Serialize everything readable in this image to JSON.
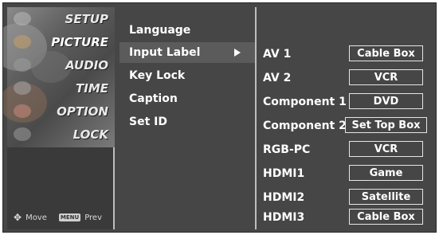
{
  "categories": [
    {
      "label": "SETUP",
      "active": false,
      "deco_color": "#b9b9b9"
    },
    {
      "label": "PICTURE",
      "active": true,
      "deco_color": "#c7a06a"
    },
    {
      "label": "AUDIO",
      "active": false,
      "deco_color": "#9a9a9a"
    },
    {
      "label": "TIME",
      "active": false,
      "deco_color": "#a8a8a8"
    },
    {
      "label": "OPTION",
      "active": false,
      "deco_color": "#c98b7a"
    },
    {
      "label": "LOCK",
      "active": false,
      "deco_color": "#9a9a9a"
    }
  ],
  "option_art_text": "OPTION",
  "hints": {
    "move_icon": "four-way-arrow-icon",
    "move_label": "Move",
    "menu_key": "MENU",
    "prev_label": "Prev"
  },
  "submenu": [
    {
      "label": "Language",
      "selected": false
    },
    {
      "label": "Input Label",
      "selected": true
    },
    {
      "label": "Key Lock",
      "selected": false
    },
    {
      "label": "Caption",
      "selected": false
    },
    {
      "label": "Set ID",
      "selected": false
    }
  ],
  "input_labels": [
    {
      "input": "AV 1",
      "label": "Cable Box"
    },
    {
      "input": "AV 2",
      "label": "VCR"
    },
    {
      "input": "Component 1",
      "label": "DVD"
    },
    {
      "input": "Component 2",
      "label": "Set Top Box"
    },
    {
      "input": "RGB-PC",
      "label": "VCR"
    },
    {
      "input": "HDMI1",
      "label": "Game"
    },
    {
      "input": "HDMI2",
      "label": "Satellite"
    },
    {
      "input": "HDMI3",
      "label": "Cable Box"
    }
  ],
  "colors": {
    "panel_bg": "#464646",
    "text": "#ffffff",
    "divider": "#bdbdbd",
    "selected_bg": "#5b5b5b"
  }
}
